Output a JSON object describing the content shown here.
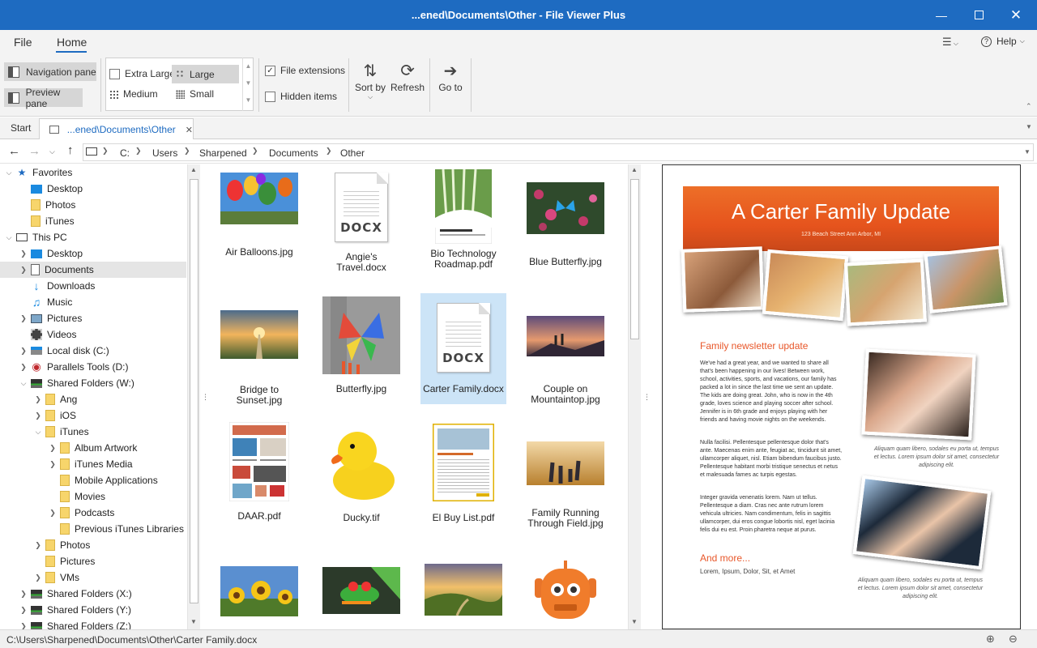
{
  "window": {
    "title": "...ened\\Documents\\Other - File Viewer Plus"
  },
  "menu": {
    "file": "File",
    "home": "Home",
    "help": "Help"
  },
  "ribbon": {
    "navigation_pane": "Navigation pane",
    "preview_pane": "Preview pane",
    "extra_large": "Extra Large",
    "large": "Large",
    "medium": "Medium",
    "small": "Small",
    "file_extensions": "File extensions",
    "hidden_items": "Hidden items",
    "sort_by": "Sort by",
    "refresh": "Refresh",
    "go_to": "Go to"
  },
  "tabs": {
    "start": "Start",
    "current": "...ened\\Documents\\Other"
  },
  "breadcrumb": [
    "C:",
    "Users",
    "Sharpened",
    "Documents",
    "Other"
  ],
  "nav": {
    "favorites": "Favorites",
    "fav_desktop": "Desktop",
    "fav_photos": "Photos",
    "fav_itunes": "iTunes",
    "this_pc": "This PC",
    "desktop": "Desktop",
    "documents": "Documents",
    "downloads": "Downloads",
    "music": "Music",
    "pictures": "Pictures",
    "videos": "Videos",
    "local_disk": "Local disk (C:)",
    "parallels": "Parallels Tools (D:)",
    "shared_w": "Shared Folders (W:)",
    "ang": "Ang",
    "ios": "iOS",
    "itunes": "iTunes",
    "album_artwork": "Album Artwork",
    "itunes_media": "iTunes Media",
    "mobile_apps": "Mobile Applications",
    "movies": "Movies",
    "podcasts": "Podcasts",
    "prev_libs": "Previous iTunes Libraries",
    "photos": "Photos",
    "pictures2": "Pictures",
    "vms": "VMs",
    "shared_x": "Shared Folders (X:)",
    "shared_y": "Shared Folders (Y:)",
    "shared_z": "Shared Folders (Z:)"
  },
  "files": {
    "f1": "Air Balloons.jpg",
    "f2a": "Angie's",
    "f2b": "Travel.docx",
    "f3a": "Bio Technology",
    "f3b": "Roadmap.pdf",
    "f4": "Blue Butterfly.jpg",
    "f5a": "Bridge to",
    "f5b": "Sunset.jpg",
    "f6": "Butterfly.jpg",
    "f7": "Carter Family.docx",
    "f8a": "Couple on",
    "f8b": "Mountaintop.jpg",
    "f9": "DAAR.pdf",
    "f10": "Ducky.tif",
    "f11": "El Buy List.pdf",
    "f12a": "Family Running",
    "f12b": "Through Field.jpg",
    "docx_label": "DOCX"
  },
  "preview": {
    "heading": "A Carter Family Update",
    "address": "123 Beach Street Ann Arbor, MI",
    "section": "Family newsletter update",
    "p1": "We've had a great year, and we wanted to share all that's been happening in our lives!  Between work, school, activities, sports, and vacations, our family has packed a lot in since the last time we sent an update.  The kids are doing great.  John, who is now in the 4th grade, loves science and playing soccer after school.  Jennifer is in 6th grade and enjoys playing with her friends and having movie nights on the weekends.",
    "p2": "Nulla facilisi. Pellentesque pellentesque dolor that's ante. Maecenas enim ante, feugiat ac, tincidunt sit amet, ullamcorper aliquet, nisl. Etiam bibendum faucibus justo. Pellentesque habitant morbi tristique senectus et netus et malesuada fames ac turpis egestas.",
    "p3": "Integer gravida venenatis lorem.  Nam ut tellus. Pellentesque a diam.  Cras nec ante rutrum lorem vehicula ultricies. Nam condimentum, felis in sagittis ullamcorper, dui eros congue lobortis nisl, eget lacinia felis dui eu est. Proin pharetra neque at purus.",
    "caption1": "Aliquam quam libero, sodales eu porta ut, tempus et lectus. Lorem ipsum dolor sit amet, consectetur adipiscing elit.",
    "caption2": "Aliquam quam libero, sodales eu porta ut, tempus et lectus. Lorem ipsum dolor sit amet, consectetur adipiscing elit.",
    "more": "And more...",
    "more_text": "Lorem, Ipsum, Dolor, Sit, et Amet"
  },
  "status": {
    "path": "C:\\Users\\Sharpened\\Documents\\Other\\Carter Family.docx"
  },
  "colors": {
    "titlebar": "#1e6bc1",
    "selection": "#cce4f7",
    "accent": "#e8572a"
  }
}
